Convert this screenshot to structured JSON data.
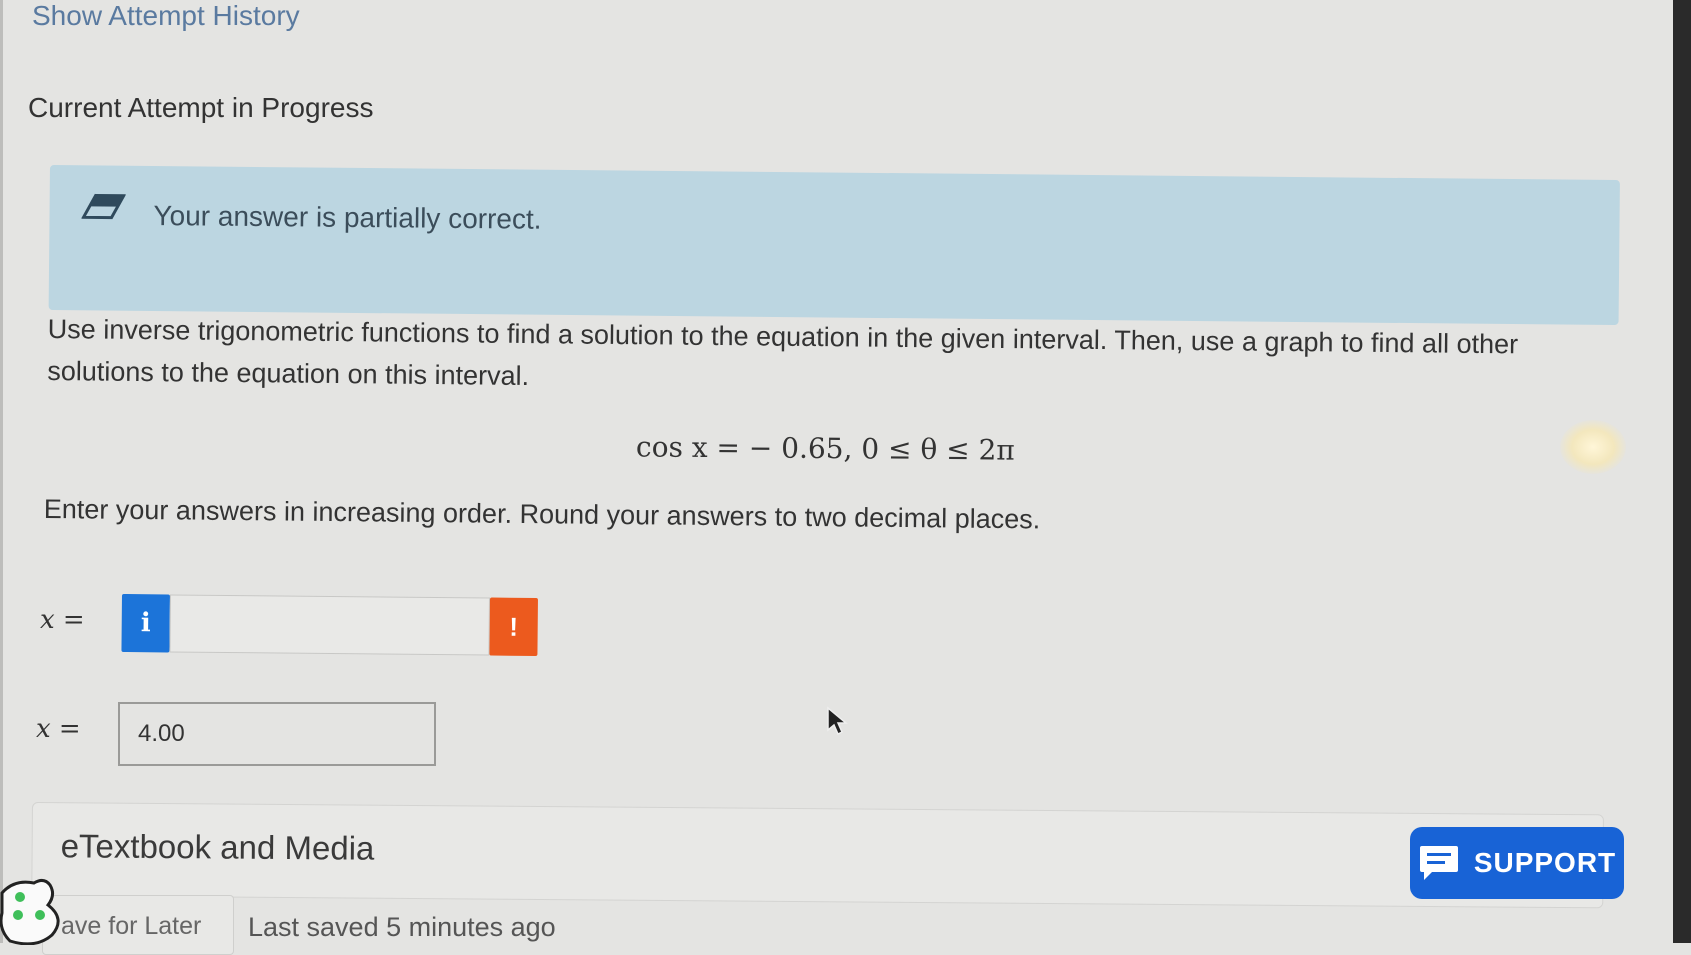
{
  "header": {
    "attempt_history_link": "Show Attempt History",
    "section_title": "Current Attempt in Progress"
  },
  "feedback": {
    "icon": "eraser-icon",
    "message": "Your answer is partially correct."
  },
  "question": {
    "prompt": "Use inverse trigonometric functions to find a solution to the equation in the given interval. Then, use a graph to find all other solutions to the equation on this interval.",
    "equation": "cos x = − 0.65, 0 ≤ θ ≤ 2π",
    "instructions": "Enter your answers in increasing order. Round your answers to two decimal places."
  },
  "answers": [
    {
      "label": "x =",
      "value": "",
      "info_icon": "i",
      "alert_icon": "!"
    },
    {
      "label": "x =",
      "value": "4.00"
    }
  ],
  "etextbook": {
    "label": "eTextbook and Media"
  },
  "support": {
    "label": "SUPPORT",
    "icon": "chat-icon"
  },
  "footer": {
    "save_for_later": "ave for Later",
    "last_saved": "Last saved 5 minutes ago"
  },
  "colors": {
    "feedback_bg": "#bcd6e1",
    "info_blue": "#1c74d9",
    "alert_orange": "#ec5a1e",
    "support_blue": "#1863d6",
    "link_blue": "#5a7aa0"
  }
}
